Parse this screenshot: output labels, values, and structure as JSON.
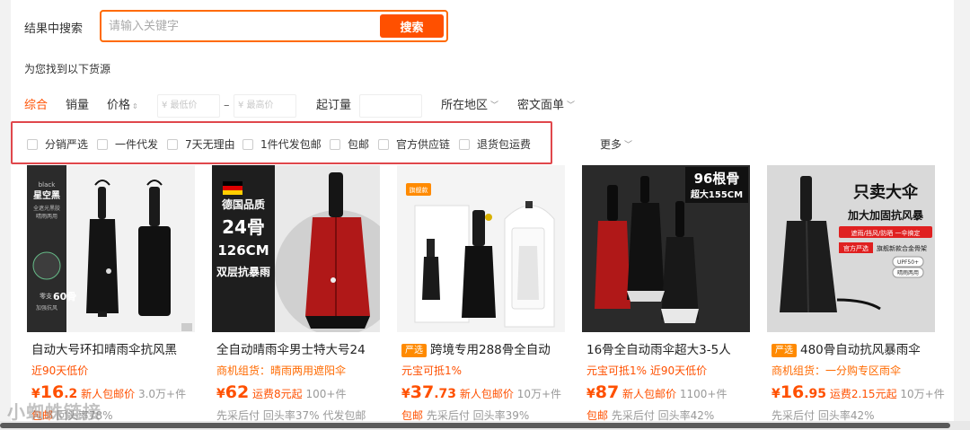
{
  "search": {
    "label": "结果中搜索",
    "placeholder": "请输入关键字",
    "button": "搜索"
  },
  "found_text": "为您找到以下货源",
  "sort": {
    "comprehensive": "综合",
    "sales": "销量",
    "price": "价格",
    "price_min_placeholder": "¥ 最低价",
    "price_max_placeholder": "¥ 最高价",
    "dash": "–",
    "moq": "起订量",
    "region": "所在地区",
    "waybill": "密文面单"
  },
  "filters": [
    "分销严选",
    "一件代发",
    "7天无理由",
    "1件代发包邮",
    "包邮",
    "官方供应链",
    "退货包运费"
  ],
  "more": "更多",
  "products": [
    {
      "title": "自动大号环扣晴雨伞抗风黑",
      "sub": "近90天低价",
      "yen": "¥",
      "price_int": "16",
      "price_dec": ".2",
      "promo": "新人包邮价",
      "sold": "3.0万+件",
      "tag1": "包邮",
      "tag2": "回头率78%",
      "img_text": [
        "black",
        "星空黑",
        "全遮光黑胶",
        "晴雨两用",
        "零支",
        "60骨",
        "加强抗风"
      ]
    },
    {
      "title": "全自动晴雨伞男士特大号24",
      "sub": "商机组货：晴雨两用遮阳伞",
      "yen": "¥",
      "price_int": "62",
      "price_dec": "",
      "promo": "运费8元起",
      "sold": "100+件",
      "tag1": "先采后付",
      "tag2": "回头率37% 代发包邮",
      "img_text": [
        "德国品质",
        "24骨",
        "126CM",
        "双层抗暴雨"
      ]
    },
    {
      "badge": "严选",
      "title": "跨境专用288骨全自动",
      "sub": "元宝可抵1%",
      "yen": "¥",
      "price_int": "37",
      "price_dec": ".73",
      "promo": "新人包邮价",
      "sold": "10万+件",
      "tag1": "包邮",
      "tag2": "先采后付 回头率39%",
      "img_text": [
        "旗舰款"
      ]
    },
    {
      "title": "16骨全自动雨伞超大3-5人",
      "sub": "元宝可抵1%",
      "sub2": "近90天低价",
      "yen": "¥",
      "price_int": "87",
      "price_dec": "",
      "promo": "新人包邮价",
      "sold": "1100+件",
      "tag1": "包邮",
      "tag2": "先采后付 回头率42%",
      "img_text": [
        "96根骨",
        "超大155CM"
      ]
    },
    {
      "badge": "严选",
      "title": "480骨自动抗风暴雨伞",
      "sub": "商机组货：一分购专区雨伞",
      "yen": "¥",
      "price_int": "16",
      "price_dec": ".95",
      "promo": "运费2.15元起",
      "sold": "10万+件",
      "tag1": "先采后付",
      "tag2": "回头率42%",
      "img_text": [
        "只卖大伞",
        "加大加固抗风暴",
        "遮雨/挡风/防晒 一伞搞定",
        "官方严选",
        "旗舰新款合金骨架",
        "UPF50+",
        "晴雨两用"
      ]
    }
  ],
  "watermark": "小蜘蛛链接"
}
